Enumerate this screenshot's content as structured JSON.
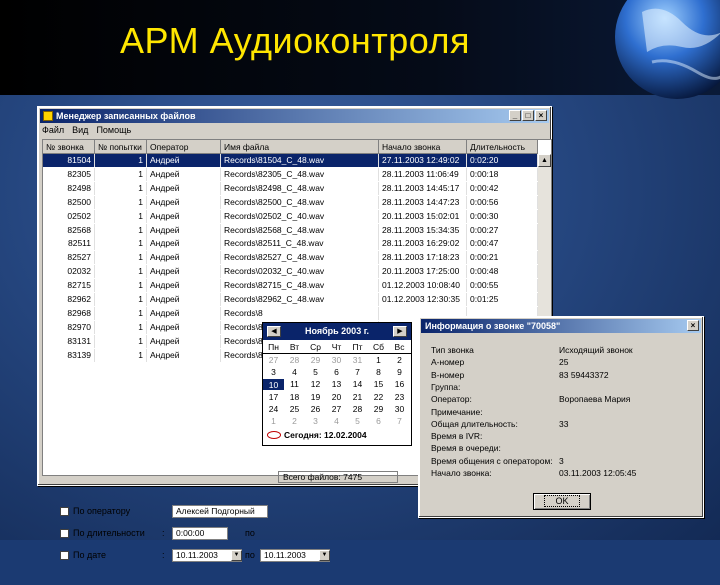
{
  "slide": {
    "title": "АРМ Аудиоконтроля"
  },
  "file_manager": {
    "title": "Менеджер записанных файлов",
    "menu": [
      "Файл",
      "Вид",
      "Помощь"
    ],
    "columns": [
      "№ звонка",
      "№ попытки",
      "Оператор",
      "Имя файла",
      "Начало звонка",
      "Длительность"
    ],
    "rows": [
      [
        "81504",
        "1",
        "Андрей",
        "Records\\81504_C_48.wav",
        "27.11.2003 12:49:02",
        "0:02:20"
      ],
      [
        "82305",
        "1",
        "Андрей",
        "Records\\82305_C_48.wav",
        "28.11.2003 11:06:49",
        "0:00:18"
      ],
      [
        "82498",
        "1",
        "Андрей",
        "Records\\82498_C_48.wav",
        "28.11.2003 14:45:17",
        "0:00:42"
      ],
      [
        "82500",
        "1",
        "Андрей",
        "Records\\82500_C_48.wav",
        "28.11.2003 14:47:23",
        "0:00:56"
      ],
      [
        "02502",
        "1",
        "Андрей",
        "Records\\02502_C_40.wav",
        "20.11.2003 15:02:01",
        "0:00:30"
      ],
      [
        "82568",
        "1",
        "Андрей",
        "Records\\82568_C_48.wav",
        "28.11.2003 15:34:35",
        "0:00:27"
      ],
      [
        "82511",
        "1",
        "Андрей",
        "Records\\82511_C_48.wav",
        "28.11.2003 16:29:02",
        "0:00:47"
      ],
      [
        "82527",
        "1",
        "Андрей",
        "Records\\82527_C_48.wav",
        "28.11.2003 17:18:23",
        "0:00:21"
      ],
      [
        "02032",
        "1",
        "Андрей",
        "Records\\02032_C_40.wav",
        "20.11.2003 17:25:00",
        "0:00:48"
      ],
      [
        "82715",
        "1",
        "Андрей",
        "Records\\82715_C_48.wav",
        "01.12.2003 10:08:40",
        "0:00:55"
      ],
      [
        "82962",
        "1",
        "Андрей",
        "Records\\82962_C_48.wav",
        "01.12.2003 12:30:35",
        "0:01:25"
      ],
      [
        "82968",
        "1",
        "Андрей",
        "Records\\8",
        "",
        ""
      ],
      [
        "82970",
        "1",
        "Андрей",
        "Records\\8",
        "",
        ""
      ],
      [
        "83131",
        "1",
        "Андрей",
        "Records\\8",
        "",
        ""
      ],
      [
        "83139",
        "1",
        "Андрей",
        "Records\\8",
        "",
        ""
      ]
    ],
    "filters": {
      "by_operator": {
        "label": "По оператору",
        "value": "Алексей Подгорный"
      },
      "by_duration": {
        "label": "По длительности",
        "sep1": ":",
        "value": "0:00:00",
        "sep2": "по"
      },
      "by_date": {
        "label": "По дате",
        "sep1": ":",
        "from": "10.11.2003",
        "sep2": "по",
        "to": "10.11.2003"
      }
    },
    "status": "Всего файлов: 7475"
  },
  "calendar": {
    "title": "Ноябрь 2003 г.",
    "weekdays": [
      "Пн",
      "Вт",
      "Ср",
      "Чт",
      "Пт",
      "Сб",
      "Вс"
    ],
    "weeks": [
      [
        "27",
        "28",
        "29",
        "30",
        "31",
        "1",
        "2"
      ],
      [
        "3",
        "4",
        "5",
        "6",
        "7",
        "8",
        "9"
      ],
      [
        "10",
        "11",
        "12",
        "13",
        "14",
        "15",
        "16"
      ],
      [
        "17",
        "18",
        "19",
        "20",
        "21",
        "22",
        "23"
      ],
      [
        "24",
        "25",
        "26",
        "27",
        "28",
        "29",
        "30"
      ],
      [
        "1",
        "2",
        "3",
        "4",
        "5",
        "6",
        "7"
      ]
    ],
    "today_label": "Сегодня: 12.02.2004"
  },
  "call_info": {
    "title": "Информация о звонке \"70058\"",
    "fields": [
      {
        "label": "Тип звонка",
        "value": "Исходящий звонок"
      },
      {
        "label": "А-номер",
        "value": "25"
      },
      {
        "label": "В-номер",
        "value": "83 59443372"
      },
      {
        "label": "Группа:",
        "value": ""
      },
      {
        "label": "Оператор:",
        "value": "Воропаева Мария"
      },
      {
        "label": "Примечание:",
        "value": ""
      },
      {
        "label": "Общая длительность:",
        "value": "33"
      },
      {
        "label": "Время в IVR:",
        "value": ""
      },
      {
        "label": "Время в очереди:",
        "value": ""
      },
      {
        "label": "Время общения с оператором:",
        "value": "3"
      },
      {
        "label": "Начало звонка:",
        "value": "03.11.2003 12:05:45"
      }
    ],
    "ok_label": "OK"
  }
}
